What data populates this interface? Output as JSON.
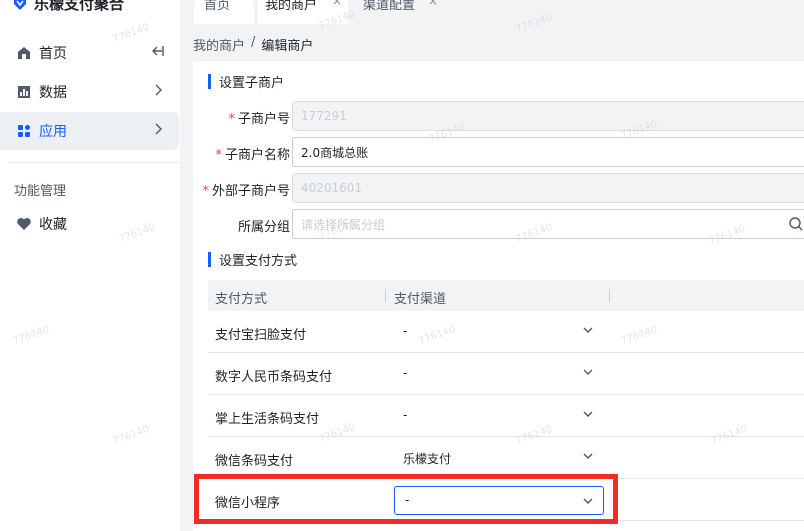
{
  "app": {
    "title": "乐檬支付聚合"
  },
  "tabs": [
    {
      "label": "首页",
      "closable": false
    },
    {
      "label": "我的商户",
      "closable": true,
      "close_glyph": "×"
    },
    {
      "label": "渠道配置",
      "closable": true,
      "close_glyph": "×"
    }
  ],
  "sidebar": {
    "items": [
      {
        "label": "首页",
        "icon": "home-icon",
        "trail": "collapse-icon"
      },
      {
        "label": "数据",
        "icon": "chart-icon",
        "trail": "chevron-right-icon"
      },
      {
        "label": "应用",
        "icon": "grid-icon",
        "trail": "chevron-right-icon",
        "active": true
      }
    ],
    "section_title": "功能管理",
    "favorites": {
      "label": "收藏",
      "icon": "heart-icon"
    }
  },
  "breadcrumb": {
    "parent": "我的商户",
    "sep": "/",
    "current": "编辑商户"
  },
  "form": {
    "section1_title": "设置子商户",
    "fields": [
      {
        "label": "子商户号",
        "required": true,
        "value": "177291",
        "disabled": true
      },
      {
        "label": "子商户名称",
        "required": true,
        "value": "2.0商城总账",
        "disabled": false
      },
      {
        "label": "外部子商户号",
        "required": true,
        "value": "40201601",
        "disabled": true
      },
      {
        "label": "所属分组",
        "required": false,
        "value": "",
        "placeholder": "请选择所属分组",
        "disabled": false
      }
    ],
    "required_mark": "*"
  },
  "payment": {
    "section_title": "设置支付方式",
    "columns": [
      "支付方式",
      "支付渠道"
    ],
    "rows": [
      {
        "method": "支付宝扫脸支付",
        "channel": "-"
      },
      {
        "method": "数字人民币条码支付",
        "channel": "-"
      },
      {
        "method": "掌上生活条码支付",
        "channel": "-"
      },
      {
        "method": "微信条码支付",
        "channel": "乐檬支付"
      },
      {
        "method": "微信小程序",
        "channel": "-",
        "focused": true
      }
    ]
  },
  "watermark": "776140",
  "colors": {
    "accent": "#165dff",
    "required": "#f53f3f",
    "highlight": "#ef2b2b"
  }
}
